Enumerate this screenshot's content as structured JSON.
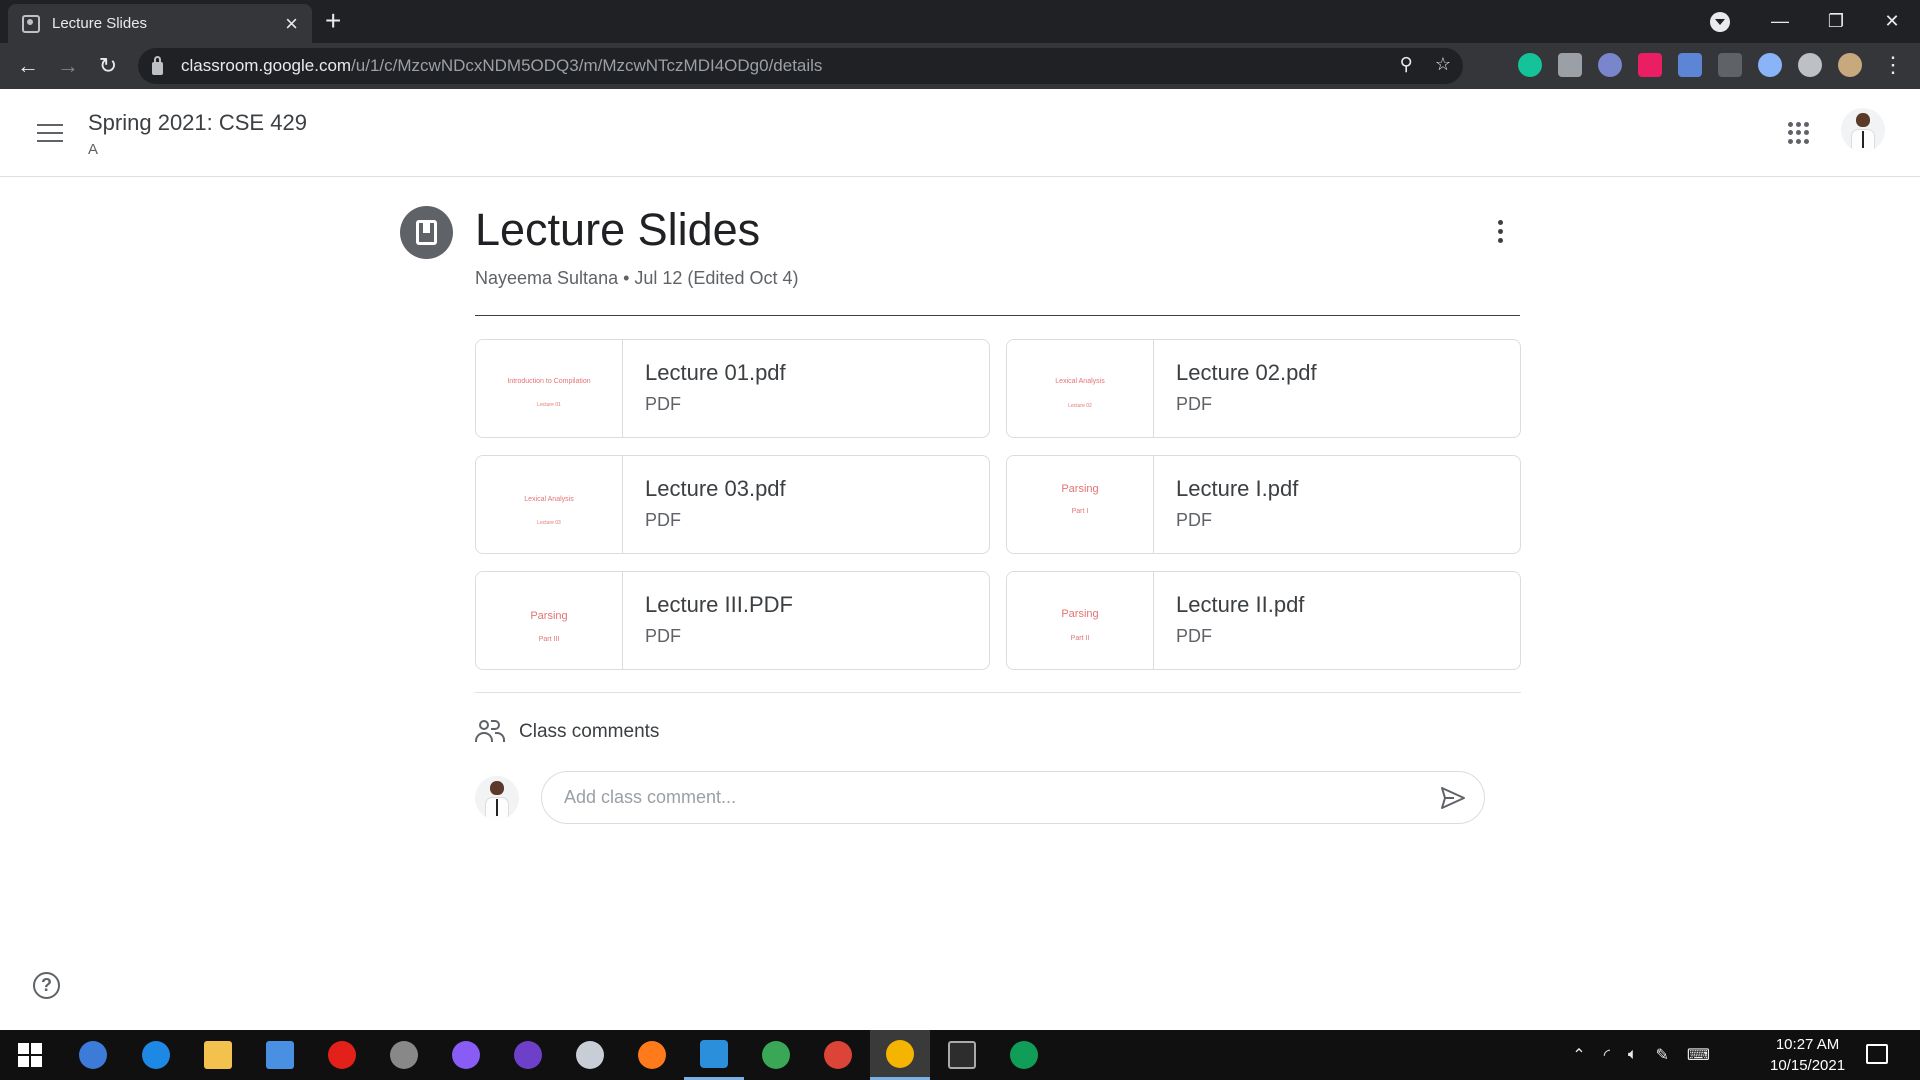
{
  "browser": {
    "tab_title": "Lecture Slides",
    "new_tab": "+",
    "url_host": "classroom.google.com",
    "url_path": "/u/1/c/MzcwNDcxNDM5ODQ3/m/MzcwNTczMDI4ODg0/details",
    "window_controls": {
      "minimize": "—",
      "restore": "❐",
      "close": "✕"
    }
  },
  "app_header": {
    "course_title": "Spring 2021: CSE 429",
    "course_section": "A"
  },
  "material": {
    "title": "Lecture Slides",
    "meta": "Nayeema Sultana • Jul 12 (Edited Oct 4)"
  },
  "attachments": [
    {
      "name": "Lecture 01.pdf",
      "type": "PDF",
      "thumb_line1": "Introduction to Compilation",
      "thumb_line2": "Lecture 01"
    },
    {
      "name": "Lecture 02.pdf",
      "type": "PDF",
      "thumb_line1": "Lexical Analysis",
      "thumb_line2": "Lecture 02"
    },
    {
      "name": "Lecture 03.pdf",
      "type": "PDF",
      "thumb_line1": "Lexical Analysis",
      "thumb_line2": "Lecture 03"
    },
    {
      "name": "Lecture I.pdf",
      "type": "PDF",
      "thumb_line1": "Parsing",
      "thumb_line2": "Part I"
    },
    {
      "name": "Lecture III.PDF",
      "type": "PDF",
      "thumb_line1": "Parsing",
      "thumb_line2": "Part III"
    },
    {
      "name": "Lecture II.pdf",
      "type": "PDF",
      "thumb_line1": "Parsing",
      "thumb_line2": "Part II"
    }
  ],
  "comments": {
    "label": "Class comments",
    "placeholder": "Add class comment..."
  },
  "help": "?",
  "taskbar": {
    "time": "10:27 AM",
    "date": "10/15/2021"
  },
  "colors": {
    "chrome_dark": "#202124",
    "chrome_toolbar": "#35363a",
    "text_primary": "#3c4043",
    "text_secondary": "#5f6368",
    "thumb_text": "#e57373",
    "taskbar": "#101010"
  }
}
